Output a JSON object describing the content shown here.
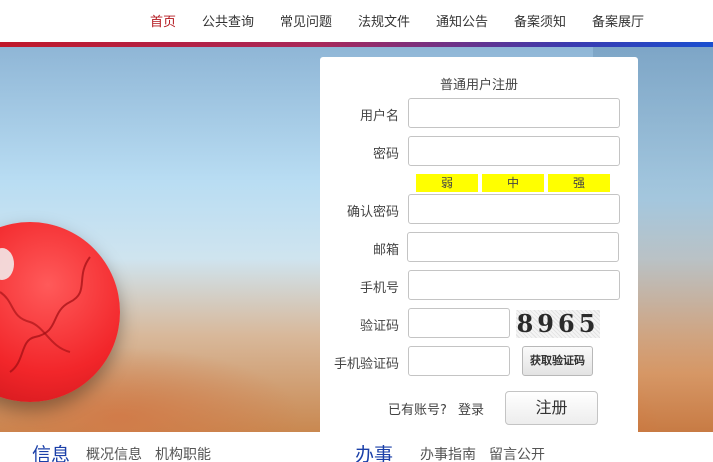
{
  "nav": {
    "items": [
      {
        "label": "首页",
        "active": true
      },
      {
        "label": "公共查询",
        "active": false
      },
      {
        "label": "常见问题",
        "active": false
      },
      {
        "label": "法规文件",
        "active": false
      },
      {
        "label": "通知公告",
        "active": false
      },
      {
        "label": "备案须知",
        "active": false
      },
      {
        "label": "备案展厅",
        "active": false
      }
    ]
  },
  "form": {
    "title": "普通用户注册",
    "username_label": "用户名",
    "password_label": "密码",
    "strength": {
      "weak": "弱",
      "medium": "中",
      "strong": "强"
    },
    "confirm_label": "确认密码",
    "email_label": "邮箱",
    "phone_label": "手机号",
    "captcha_label": "验证码",
    "captcha_text": "8965",
    "sms_label": "手机验证码",
    "sms_button": "获取验证码",
    "have_account": "已有账号?",
    "login_link": "登录",
    "register_button": "注册"
  },
  "bottom": {
    "info_title": "信息",
    "info_links": [
      "概况信息",
      "机构职能"
    ],
    "service_title": "办事",
    "service_links": [
      "办事指南",
      "留言公开"
    ]
  },
  "colors": {
    "nav_active": "#b3181f",
    "section_title": "#1a3fa8",
    "strength_bar": "#ffff00"
  }
}
